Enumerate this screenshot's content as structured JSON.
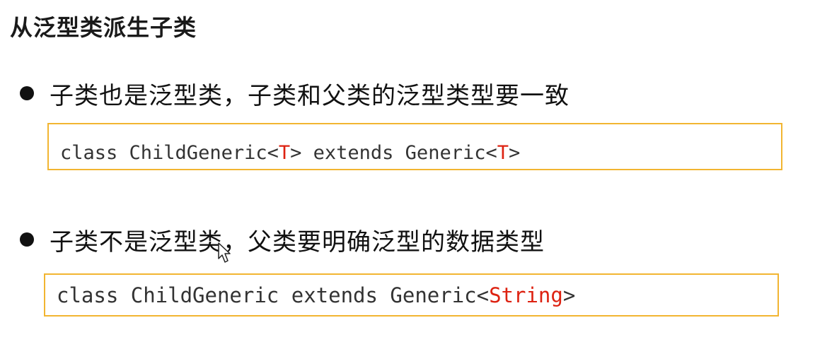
{
  "page": {
    "title": "从泛型类派生子类"
  },
  "bullets": [
    {
      "text": "子类也是泛型类，子类和父类的泛型类型要一致",
      "code": {
        "before": "class ChildGeneric<",
        "type1": "T",
        "middle": "> extends Generic<",
        "type2": "T",
        "after": ">"
      }
    },
    {
      "text": "子类不是泛型类，父类要明确泛型的数据类型",
      "code": {
        "before": "class ChildGeneric extends Generic<",
        "type1": "String",
        "after": ">"
      }
    }
  ],
  "colors": {
    "accent_border": "#f2b531",
    "type_param": "#dd2211"
  },
  "icons": {
    "bullet": "filled-circle",
    "cursor": "mouse-pointer"
  }
}
